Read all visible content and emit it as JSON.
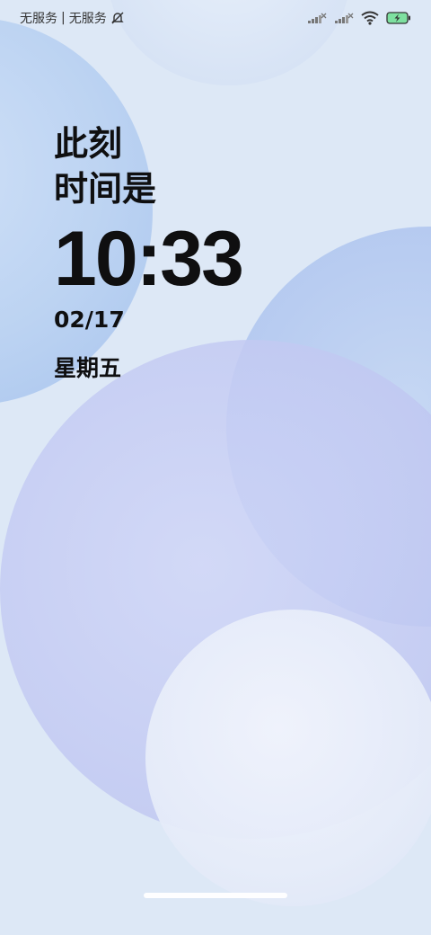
{
  "status_bar": {
    "carrier_1": "无服务",
    "separator": "|",
    "carrier_2": "无服务",
    "icons": [
      "bell-muted-icon",
      "signal-icon",
      "signal-icon",
      "wifi-icon",
      "battery-charging-icon"
    ]
  },
  "lock_screen": {
    "line_1": "此刻",
    "line_2": "时间是",
    "time": "10:33",
    "date": "02/17",
    "weekday": "星期五"
  },
  "colors": {
    "background": "#dde8f6",
    "text": "#0f0f10",
    "battery": "#7ee0a0"
  }
}
